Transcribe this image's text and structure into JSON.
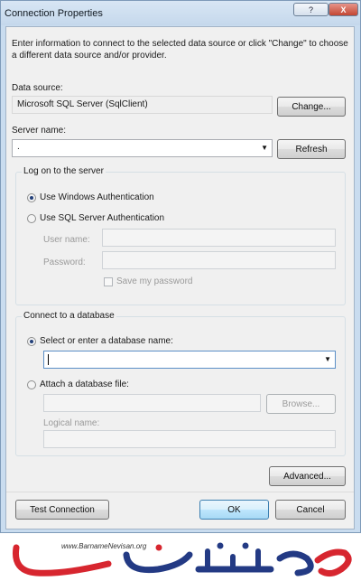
{
  "window": {
    "title": "Connection Properties",
    "help_glyph": "?",
    "close_glyph": "X"
  },
  "intro": "Enter information to connect to the selected data source or click \"Change\" to choose a different data source and/or provider.",
  "data_source": {
    "label": "Data source:",
    "value": "Microsoft SQL Server (SqlClient)",
    "change_button": "Change..."
  },
  "server": {
    "label": "Server name:",
    "value": ".",
    "refresh_button": "Refresh"
  },
  "logon": {
    "legend": "Log on to the server",
    "windows_auth": "Use Windows Authentication",
    "sql_auth": "Use SQL Server Authentication",
    "username_label": "User name:",
    "password_label": "Password:",
    "save_password": "Save my password"
  },
  "database": {
    "legend": "Connect to a database",
    "select_option": "Select or enter a database name:",
    "attach_option": "Attach a database file:",
    "browse_button": "Browse...",
    "logical_name_label": "Logical name:"
  },
  "buttons": {
    "advanced": "Advanced...",
    "test_connection": "Test Connection",
    "ok": "OK",
    "cancel": "Cancel"
  },
  "watermark": {
    "url": "www.BarnameNevisan.org",
    "logo_text": "برنامه نویسان"
  }
}
